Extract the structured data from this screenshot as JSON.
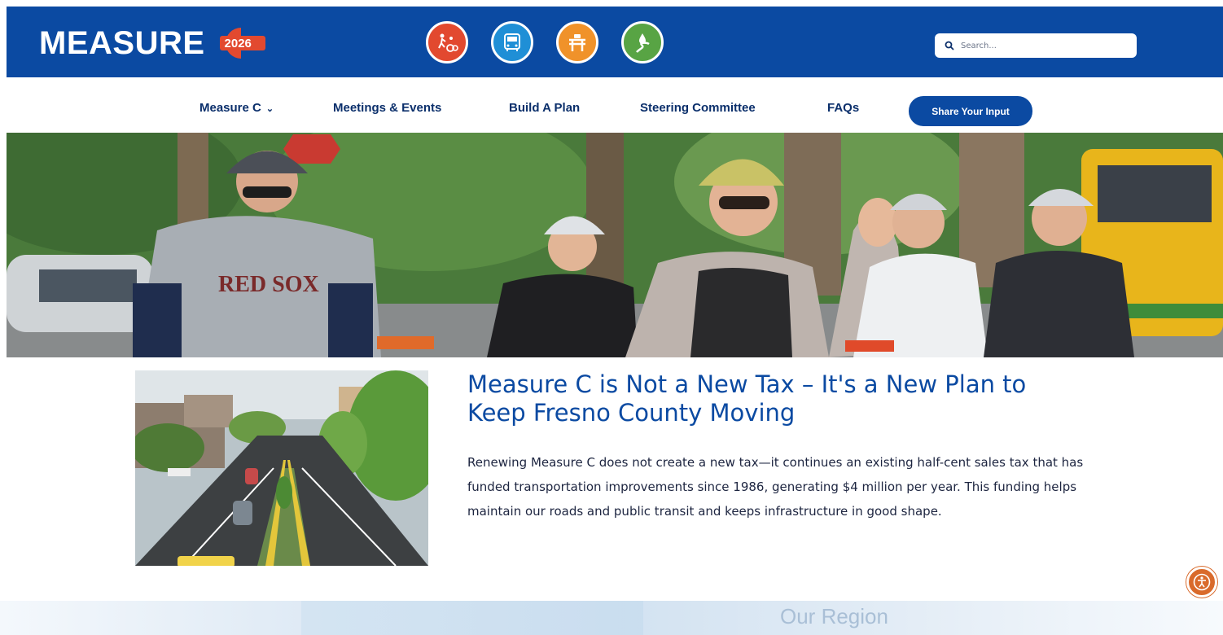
{
  "header": {
    "logo_text": "MEASURE",
    "logo_year": "2026",
    "mode_icons": [
      {
        "name": "pedestrian-bicycle-icon",
        "color": "#e2492f"
      },
      {
        "name": "bus-icon",
        "color": "#1f8fd6"
      },
      {
        "name": "road-icon",
        "color": "#f0922a"
      },
      {
        "name": "road-water-icon",
        "color": "#58a444"
      }
    ],
    "search_placeholder": "Search..."
  },
  "nav": {
    "items": [
      {
        "label": "Measure C",
        "has_dropdown": true
      },
      {
        "label": "Meetings & Events"
      },
      {
        "label": "Build A Plan"
      },
      {
        "label": "Steering Committee"
      },
      {
        "label": "FAQs"
      }
    ],
    "cta_label": "Share Your Input"
  },
  "content": {
    "headline": "Measure C is Not a New Tax – It's a New Plan to Keep Fresno County Moving",
    "body": "Renewing Measure C does not create a new tax—it continues an existing half-cent sales tax that has funded transportation improvements since 1986, generating $4 million per year. This funding helps maintain our roads and public transit and keeps infrastructure in good shape."
  },
  "bottom": {
    "partial_heading": "Our Region"
  },
  "colors": {
    "brand_blue": "#0b4aa2",
    "nav_text": "#0b2f6b",
    "logo_red": "#e2492f",
    "a11y_orange": "#d96a2b"
  }
}
